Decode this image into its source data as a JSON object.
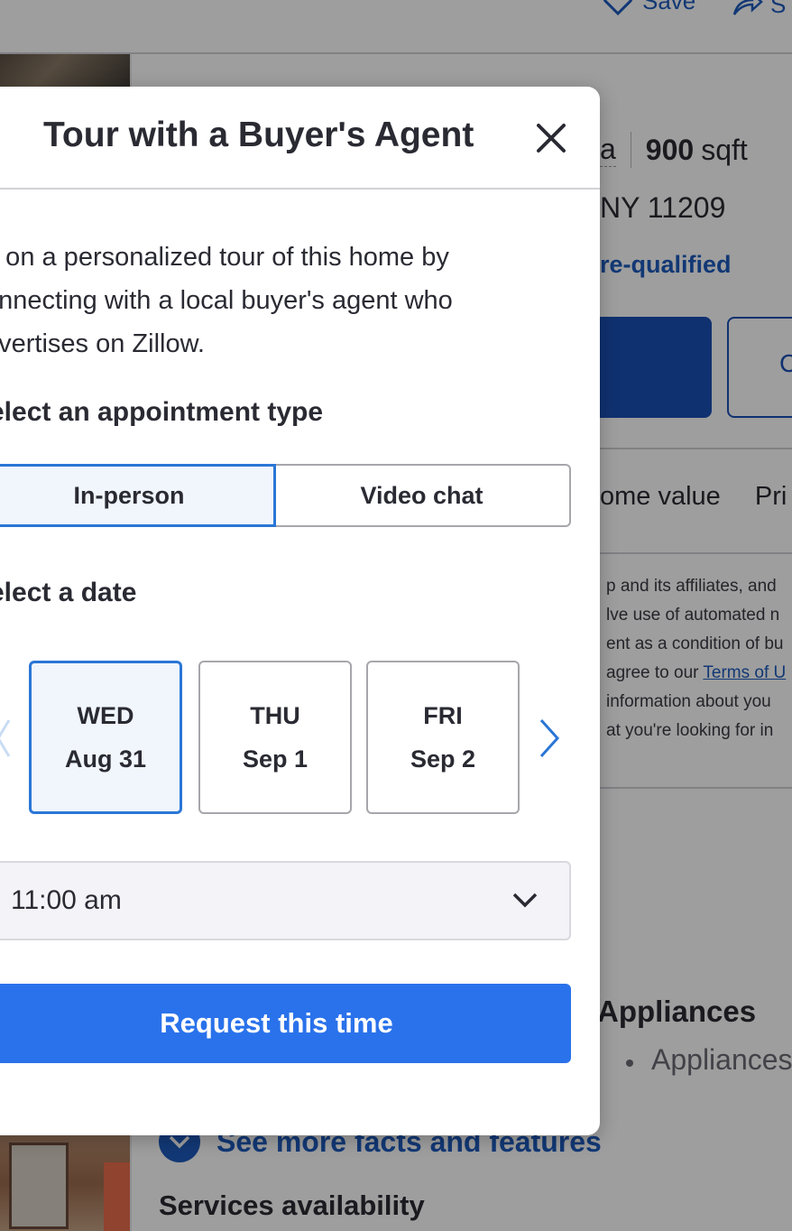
{
  "background": {
    "save_label": "Save",
    "share_label": "S",
    "facts_prefix": "a",
    "sqft_value": "900",
    "sqft_unit": "sqft",
    "address_fragment": "NY 11209",
    "prequalified_link": "re-qualified",
    "button2_label": "C",
    "tabs": [
      "ome value",
      "Pri"
    ],
    "disclaimer_lines": [
      "p and its affiliates, and",
      "lve use of automated n",
      "ent as a condition of bu",
      "agree to our ",
      " information about you",
      "at you're looking for in"
    ],
    "terms_link": "Terms of U",
    "appliances_heading": "Appliances",
    "appliances_item": "Appliances",
    "see_more": "See more facts and features",
    "services_heading": "Services availability"
  },
  "modal": {
    "title": "Tour with a Buyer's Agent",
    "description_lines": [
      "o on a personalized tour of this home by",
      "onnecting with a local buyer's agent who",
      "dvertises on Zillow."
    ],
    "appointment_label": "elect an appointment type",
    "appointment_types": {
      "selected": "In-person",
      "other": "Video chat"
    },
    "date_label": "elect a date",
    "dates": [
      {
        "day": "WED",
        "date": "Aug 31"
      },
      {
        "day": "THU",
        "date": "Sep 1"
      },
      {
        "day": "FRI",
        "date": "Sep 2"
      }
    ],
    "selected_time": "11:00 am",
    "request_button": "Request this time"
  },
  "colors": {
    "accent": "#2a72eb",
    "selected_border": "#2a76d6",
    "selected_fill": "#f1f6fd",
    "link_blue": "#1d5bbd"
  }
}
